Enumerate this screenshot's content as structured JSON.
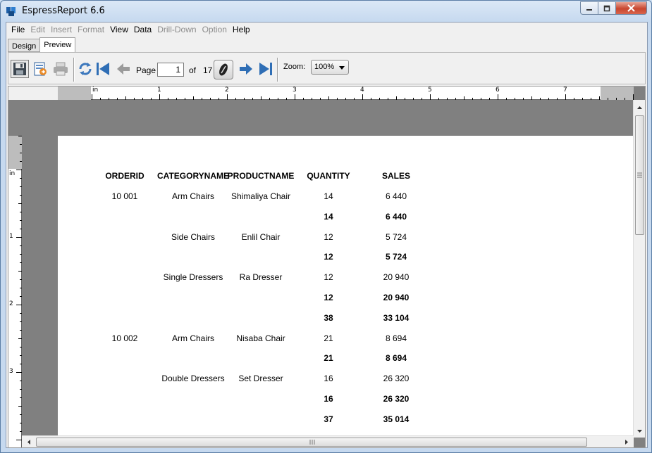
{
  "window": {
    "title": "EspressReport 6.6",
    "controls": {
      "minimize": "—",
      "maximize": "□",
      "close": "✕"
    }
  },
  "menu": [
    {
      "label": "File",
      "enabled": true
    },
    {
      "label": "Edit",
      "enabled": false
    },
    {
      "label": "Insert",
      "enabled": false
    },
    {
      "label": "Format",
      "enabled": false
    },
    {
      "label": "View",
      "enabled": true
    },
    {
      "label": "Data",
      "enabled": true
    },
    {
      "label": "Drill-Down",
      "enabled": false
    },
    {
      "label": "Option",
      "enabled": false
    },
    {
      "label": "Help",
      "enabled": true
    }
  ],
  "tabs": [
    {
      "label": "Design",
      "active": false
    },
    {
      "label": "Preview",
      "active": true
    }
  ],
  "toolbar": {
    "icons": [
      "save-icon",
      "export-icon",
      "print-icon",
      "refresh-icon",
      "first-page-icon",
      "previous-page-icon",
      "page-jump-icon",
      "next-page-icon",
      "last-page-icon"
    ],
    "page_label": "Page",
    "page_value": "1",
    "of_label": "of",
    "total_pages": "17",
    "zoom_label": "Zoom:",
    "zoom_value": "100%"
  },
  "ruler": {
    "unit": "in",
    "h_marks": [
      "1",
      "2",
      "3",
      "4",
      "5",
      "6",
      "7"
    ],
    "v_marks": [
      "1",
      "2",
      "3"
    ]
  },
  "report": {
    "headers": [
      "ORDERID",
      "CATEGORYNAME",
      "PRODUCTNAME",
      "QUANTITY",
      "SALES"
    ],
    "rows": [
      {
        "orderid": "10 001",
        "category": "Arm Chairs",
        "product": "Shimaliya Chair",
        "quantity": "14",
        "sales": "6 440",
        "bold": false
      },
      {
        "orderid": "",
        "category": "",
        "product": "",
        "quantity": "14",
        "sales": "6 440",
        "bold": true
      },
      {
        "orderid": "",
        "category": "Side Chairs",
        "product": "Enlil Chair",
        "quantity": "12",
        "sales": "5 724",
        "bold": false
      },
      {
        "orderid": "",
        "category": "",
        "product": "",
        "quantity": "12",
        "sales": "5 724",
        "bold": true
      },
      {
        "orderid": "",
        "category": "Single Dressers",
        "product": "Ra Dresser",
        "quantity": "12",
        "sales": "20 940",
        "bold": false
      },
      {
        "orderid": "",
        "category": "",
        "product": "",
        "quantity": "12",
        "sales": "20 940",
        "bold": true
      },
      {
        "orderid": "",
        "category": "",
        "product": "",
        "quantity": "38",
        "sales": "33 104",
        "bold": true
      },
      {
        "orderid": "10 002",
        "category": "Arm Chairs",
        "product": "Nisaba Chair",
        "quantity": "21",
        "sales": "8 694",
        "bold": false
      },
      {
        "orderid": "",
        "category": "",
        "product": "",
        "quantity": "21",
        "sales": "8 694",
        "bold": true
      },
      {
        "orderid": "",
        "category": "Double Dressers",
        "product": "Set Dresser",
        "quantity": "16",
        "sales": "26 320",
        "bold": false
      },
      {
        "orderid": "",
        "category": "",
        "product": "",
        "quantity": "16",
        "sales": "26 320",
        "bold": true
      },
      {
        "orderid": "",
        "category": "",
        "product": "",
        "quantity": "37",
        "sales": "35 014",
        "bold": true
      }
    ]
  }
}
